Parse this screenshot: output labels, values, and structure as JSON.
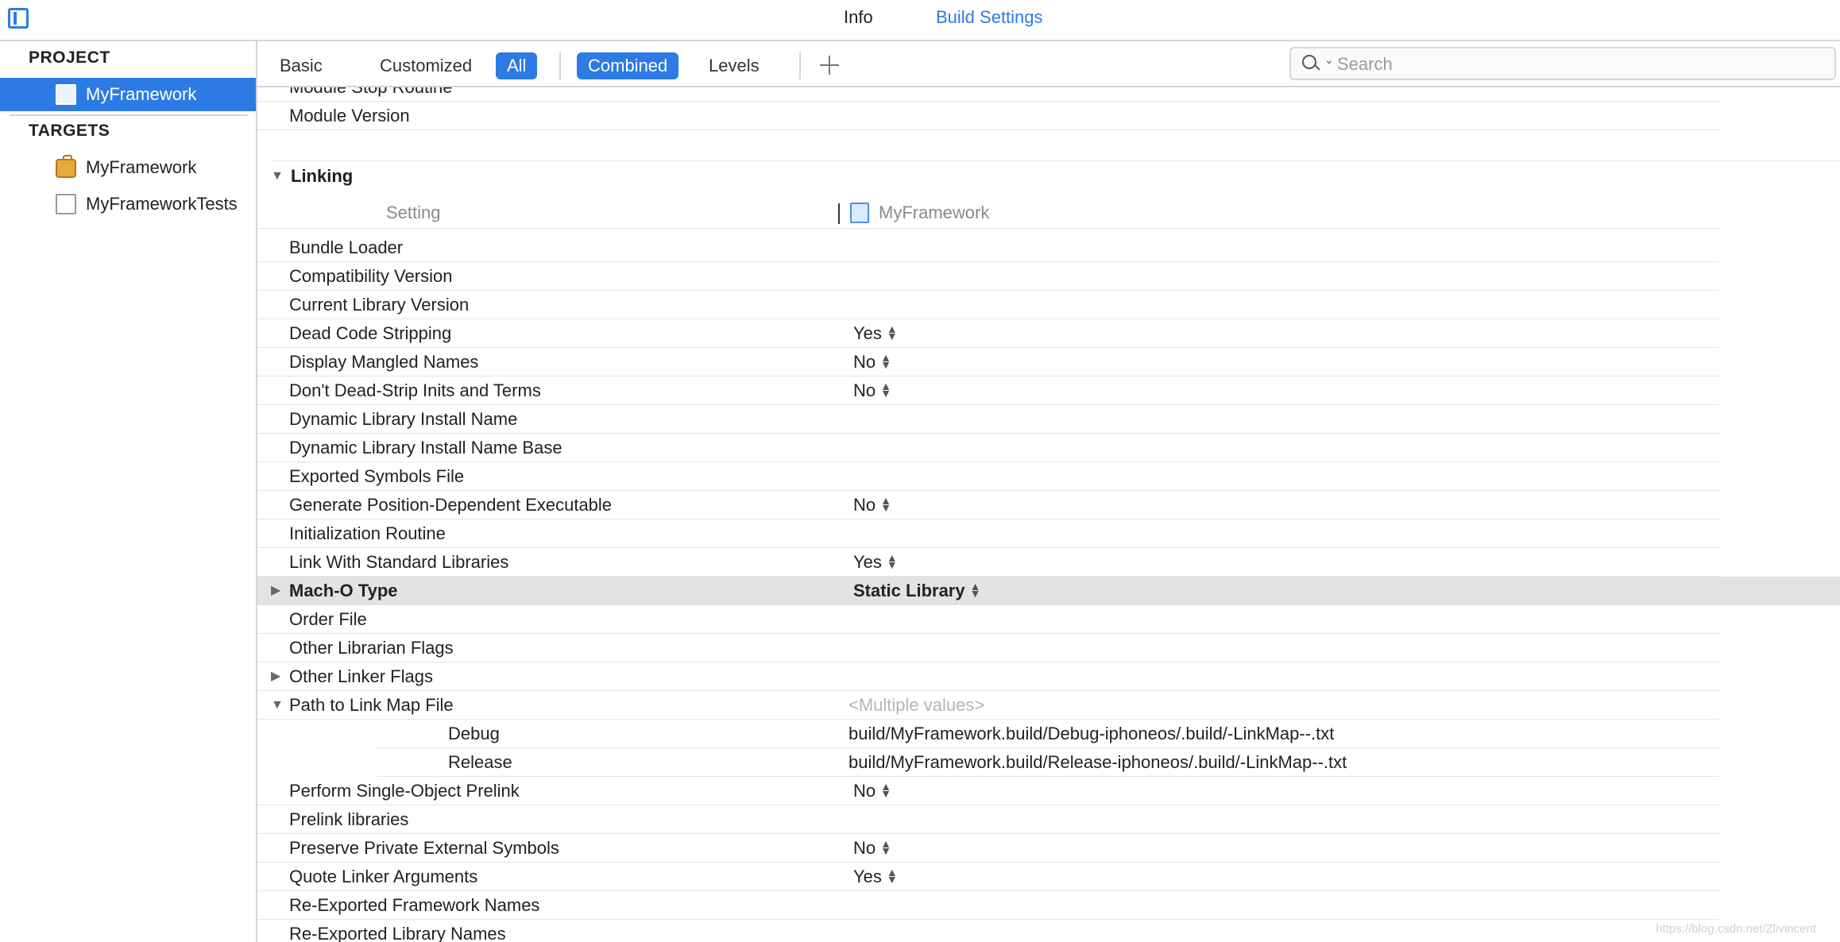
{
  "top_tabs": {
    "info": "Info",
    "build_settings": "Build Settings"
  },
  "navigator": {
    "project_header": "PROJECT",
    "project_item": "MyFramework",
    "targets_header": "TARGETS",
    "targets": [
      "MyFramework",
      "MyFrameworkTests"
    ]
  },
  "filters": {
    "basic": "Basic",
    "customized": "Customized",
    "all": "All",
    "combined": "Combined",
    "levels": "Levels"
  },
  "search": {
    "placeholder": "Search"
  },
  "partial_top": {
    "clipped_row": "Module Stop Routine",
    "module_version": "Module Version"
  },
  "linking": {
    "title": "Linking",
    "column_setting": "Setting",
    "column_target": "MyFramework",
    "rows": [
      {
        "name": "Bundle Loader",
        "value": ""
      },
      {
        "name": "Compatibility Version",
        "value": ""
      },
      {
        "name": "Current Library Version",
        "value": ""
      },
      {
        "name": "Dead Code Stripping",
        "value": "Yes"
      },
      {
        "name": "Display Mangled Names",
        "value": "No"
      },
      {
        "name": "Don't Dead-Strip Inits and Terms",
        "value": "No"
      },
      {
        "name": "Dynamic Library Install Name",
        "value": ""
      },
      {
        "name": "Dynamic Library Install Name Base",
        "value": ""
      },
      {
        "name": "Exported Symbols File",
        "value": ""
      },
      {
        "name": "Generate Position-Dependent Executable",
        "value": "No"
      },
      {
        "name": "Initialization Routine",
        "value": ""
      },
      {
        "name": "Link With Standard Libraries",
        "value": "Yes"
      },
      {
        "name": "Mach-O Type",
        "value": "Static Library"
      },
      {
        "name": "Order File",
        "value": ""
      },
      {
        "name": "Other Librarian Flags",
        "value": ""
      },
      {
        "name": "Other Linker Flags",
        "value": ""
      },
      {
        "name": "Path to Link Map File",
        "value": "<Multiple values>"
      },
      {
        "name": "Debug",
        "value": "build/MyFramework.build/Debug-iphoneos/.build/-LinkMap--.txt"
      },
      {
        "name": "Release",
        "value": "build/MyFramework.build/Release-iphoneos/.build/-LinkMap--.txt"
      },
      {
        "name": "Perform Single-Object Prelink",
        "value": "No"
      },
      {
        "name": "Prelink libraries",
        "value": ""
      },
      {
        "name": "Preserve Private External Symbols",
        "value": "No"
      },
      {
        "name": "Quote Linker Arguments",
        "value": "Yes"
      },
      {
        "name": "Re-Exported Framework Names",
        "value": ""
      },
      {
        "name": "Re-Exported Library Names",
        "value": ""
      }
    ]
  },
  "watermark": "https://blog.csdn.net/Zlivincent"
}
